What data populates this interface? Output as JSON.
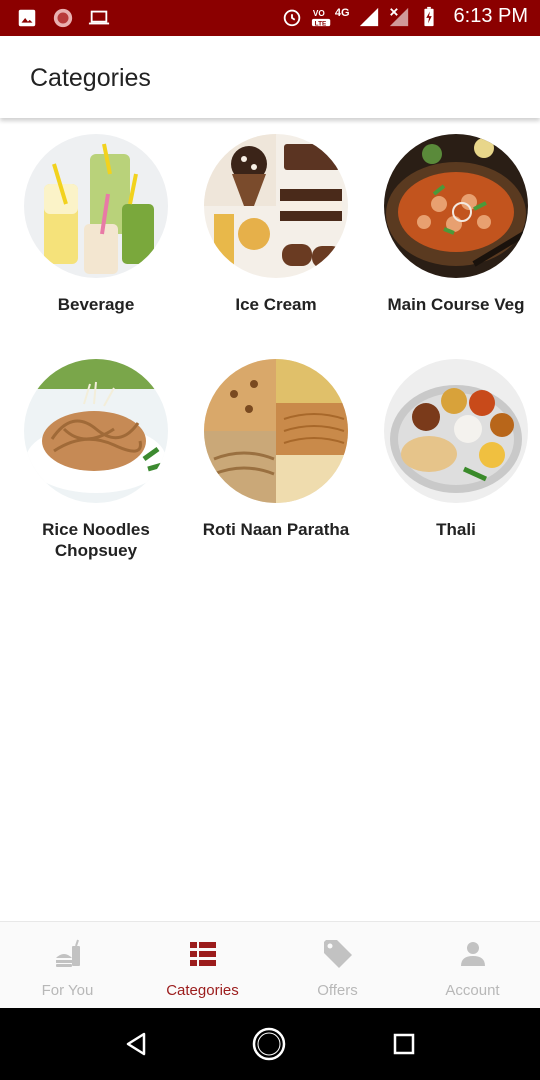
{
  "status_bar": {
    "time": "6:13 PM",
    "network": "4G",
    "volte": "LTE",
    "icons": [
      "image-icon",
      "circle-app-icon",
      "laptop-icon",
      "alarm-icon",
      "volte-icon",
      "signal-icon",
      "signal-x-icon",
      "battery-charging-icon"
    ]
  },
  "app_bar": {
    "title": "Categories"
  },
  "categories": [
    {
      "label": "Beverage",
      "image": "beverage-image"
    },
    {
      "label": "Ice Cream",
      "image": "ice-cream-image"
    },
    {
      "label": "Main Course Veg",
      "image": "main-course-veg-image"
    },
    {
      "label": "Rice Noodles Chopsuey",
      "image": "rice-noodles-image"
    },
    {
      "label": "Roti Naan Paratha",
      "image": "roti-naan-image"
    },
    {
      "label": "Thali",
      "image": "thali-image"
    }
  ],
  "bottom_nav": {
    "active": "Categories",
    "items": [
      {
        "label": "For You",
        "icon": "food-drink-icon"
      },
      {
        "label": "Categories",
        "icon": "list-icon"
      },
      {
        "label": "Offers",
        "icon": "tag-icon"
      },
      {
        "label": "Account",
        "icon": "person-icon"
      }
    ]
  },
  "colors": {
    "status_bar": "#8b0000",
    "accent": "#9b1c1c",
    "inactive": "#b8b8b8"
  }
}
